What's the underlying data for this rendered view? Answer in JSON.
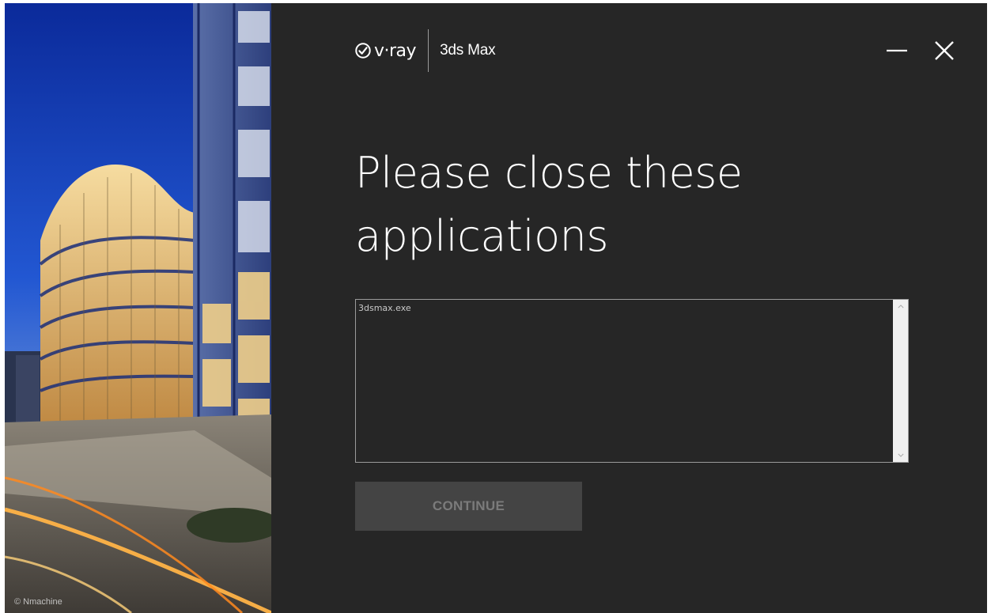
{
  "window": {
    "brand_name": "v·ray",
    "product_name": "3ds Max",
    "minimize_icon": "minimize-icon",
    "close_icon": "close-icon"
  },
  "hero": {
    "credit": "© Nmachine",
    "image": "modern glass office building at dusk with light trails"
  },
  "main": {
    "title": "Please close these applications",
    "applications": [
      "3dsmax.exe"
    ],
    "continue_label": "CONTINUE"
  },
  "colors": {
    "background": "#262626",
    "button_disabled": "#444444",
    "button_text_disabled": "#7b7b7b",
    "list_border": "#9b9b9b",
    "scrollbar": "#f0f0f0"
  }
}
